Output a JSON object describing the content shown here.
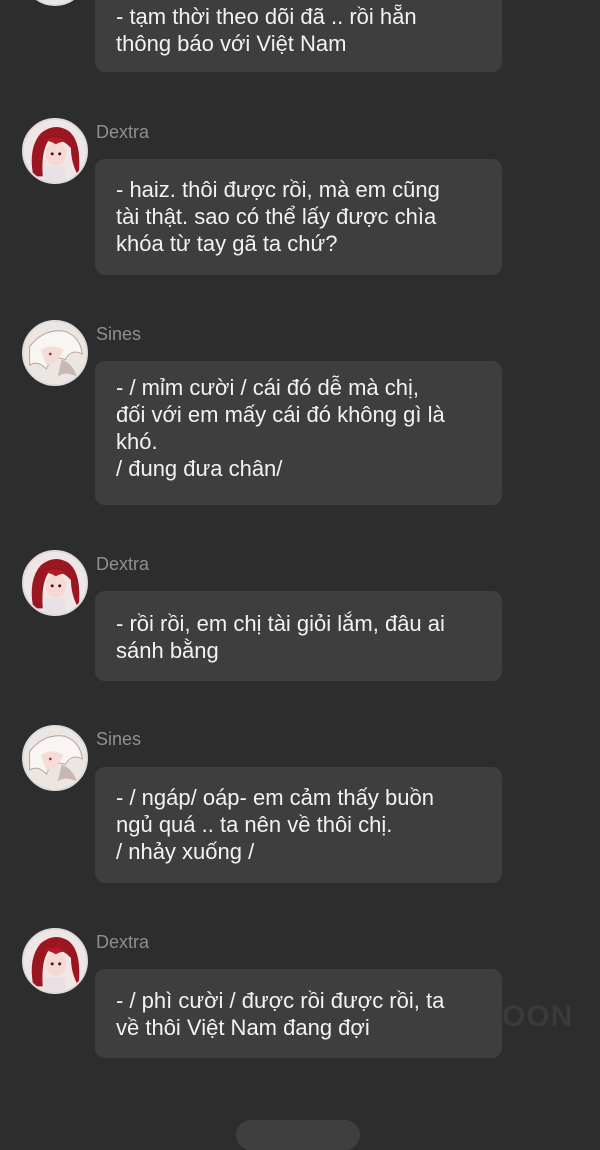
{
  "messages": [
    {
      "sender": "",
      "avatar": "",
      "lines": [
        "- tạm thời theo dõi đã .. rồi hẵn",
        "thông báo với Việt Nam"
      ]
    },
    {
      "sender": "Dextra",
      "avatar": "red-hair-avatar-icon",
      "lines": [
        "- haiz.  thôi được rồi, mà em cũng",
        "tài thật. sao có thể lấy được chìa",
        "khóa từ tay gã ta chứ?"
      ]
    },
    {
      "sender": "Sines",
      "avatar": "white-hair-avatar-icon",
      "lines": [
        "- / mỉm cười / cái đó dễ mà chị,",
        "đối với em mấy cái đó không gì là",
        "khó.",
        "/ đung đưa chân/"
      ]
    },
    {
      "sender": "Dextra",
      "avatar": "red-hair-avatar-icon",
      "lines": [
        "- rồi rồi, em chị tài giỏi lắm, đâu ai",
        "sánh bằng"
      ]
    },
    {
      "sender": "Sines",
      "avatar": "white-hair-avatar-icon",
      "lines": [
        "- / ngáp/ oáp- em cảm thấy buồn",
        "ngủ quá .. ta nên về thôi chị.",
        "/ nhảy xuống /"
      ]
    },
    {
      "sender": "Dextra",
      "avatar": "red-hair-avatar-icon",
      "lines": [
        "- / phì cười / được rồi được rồi, ta",
        "về thôi Việt Nam đang đợi"
      ]
    }
  ],
  "watermark": "OON",
  "colors": {
    "background": "#2d2d2d",
    "bubble": "#3e3e3e",
    "text": "#f2f2f2",
    "name": "#8f8f8f"
  }
}
